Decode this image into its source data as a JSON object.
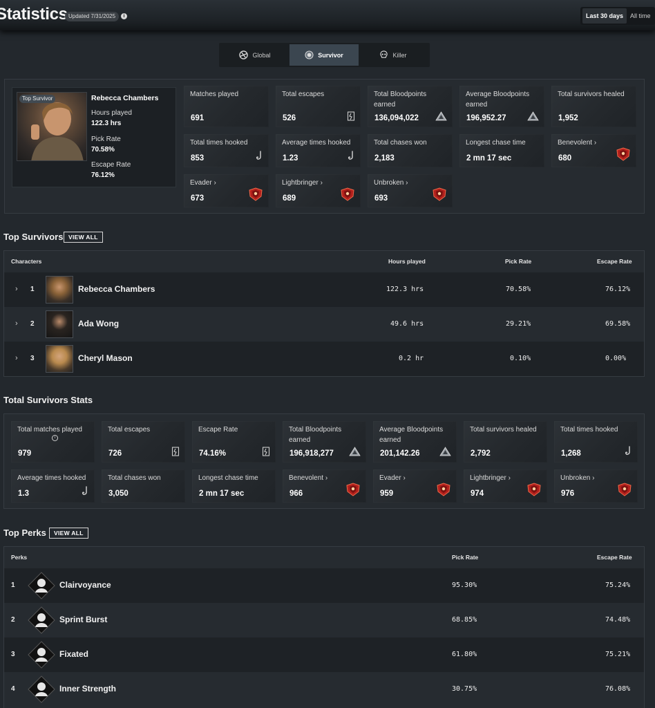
{
  "header": {
    "title": "Statistics",
    "updated": "Updated 7/31/2025",
    "info_icon": "info-icon",
    "range": {
      "active": "Last 30 days",
      "other": "All time"
    }
  },
  "tabs": [
    {
      "label": "Global",
      "icon": "global-icon"
    },
    {
      "label": "Survivor",
      "icon": "survivor-icon",
      "active": true
    },
    {
      "label": "Killer",
      "icon": "killer-icon"
    }
  ],
  "top_survivor": {
    "badge": "Top Survivor",
    "name": "Rebecca Chambers",
    "hours_label": "Hours played",
    "hours_value": "122.3 hrs",
    "pick_label": "Pick Rate",
    "pick_value": "70.58%",
    "escape_label": "Escape Rate",
    "escape_value": "76.12%"
  },
  "survivor_cards": [
    {
      "label": "Matches played",
      "value": "691",
      "icon": ""
    },
    {
      "label": "Total escapes",
      "value": "526",
      "icon": "exit-door-icon"
    },
    {
      "label": "Total Bloodpoints earned",
      "value": "136,094,022",
      "icon": "bloodpoints-icon"
    },
    {
      "label": "Average Bloodpoints earned",
      "value": "196,952.27",
      "icon": "bloodpoints-icon"
    },
    {
      "label": "Total survivors healed",
      "value": "1,952",
      "icon": ""
    },
    {
      "label": "Total times hooked",
      "value": "853",
      "icon": "hook-icon"
    },
    {
      "label": "Average times hooked",
      "value": "1.23",
      "icon": "hook-icon"
    },
    {
      "label": "Total chases won",
      "value": "2,183",
      "icon": ""
    },
    {
      "label": "Longest chase time",
      "value": "2 mn 17 sec",
      "icon": ""
    },
    {
      "label": "Benevolent ›",
      "value": "680",
      "icon": "emblem-icon"
    },
    {
      "label": "Evader ›",
      "value": "673",
      "icon": "emblem-icon"
    },
    {
      "label": "Lightbringer ›",
      "value": "689",
      "icon": "emblem-icon"
    },
    {
      "label": "Unbroken ›",
      "value": "693",
      "icon": "emblem-icon"
    }
  ],
  "top_survivors": {
    "title": "Top Survivors",
    "view_all": "VIEW ALL",
    "headers": {
      "characters": "Characters",
      "hours": "Hours played",
      "pick": "Pick Rate",
      "escape": "Escape Rate"
    },
    "rows": [
      {
        "rank": "1",
        "name": "Rebecca Chambers",
        "hours": "122.3 hrs",
        "pick": "70.58%",
        "escape": "76.12%"
      },
      {
        "rank": "2",
        "name": "Ada Wong",
        "hours": "49.6 hrs",
        "pick": "29.21%",
        "escape": "69.58%"
      },
      {
        "rank": "3",
        "name": "Cheryl Mason",
        "hours": "0.2 hr",
        "pick": "0.10%",
        "escape": "0.00%"
      }
    ]
  },
  "total_stats": {
    "title": "Total Survivors Stats",
    "cards": [
      {
        "label": "Total matches played",
        "value": "979",
        "icon": "",
        "info": true
      },
      {
        "label": "Total escapes",
        "value": "726",
        "icon": "exit-door-icon"
      },
      {
        "label": "Escape Rate",
        "value": "74.16%",
        "icon": "exit-door-icon"
      },
      {
        "label": "Total Bloodpoints earned",
        "value": "196,918,277",
        "icon": "bloodpoints-icon"
      },
      {
        "label": "Average Bloodpoints earned",
        "value": "201,142.26",
        "icon": "bloodpoints-icon"
      },
      {
        "label": "Total survivors healed",
        "value": "2,792",
        "icon": ""
      },
      {
        "label": "Total times hooked",
        "value": "1,268",
        "icon": "hook-icon"
      },
      {
        "label": "Average times hooked",
        "value": "1.3",
        "icon": "hook-icon"
      },
      {
        "label": "Total chases won",
        "value": "3,050",
        "icon": ""
      },
      {
        "label": "Longest chase time",
        "value": "2 mn 17 sec",
        "icon": ""
      },
      {
        "label": "Benevolent ›",
        "value": "966",
        "icon": "emblem-icon"
      },
      {
        "label": "Evader ›",
        "value": "959",
        "icon": "emblem-icon"
      },
      {
        "label": "Lightbringer ›",
        "value": "974",
        "icon": "emblem-icon"
      },
      {
        "label": "Unbroken ›",
        "value": "976",
        "icon": "emblem-icon"
      }
    ]
  },
  "top_perks": {
    "title": "Top Perks",
    "view_all": "VIEW ALL",
    "headers": {
      "perks": "Perks",
      "pick": "Pick Rate",
      "escape": "Escape Rate"
    },
    "rows": [
      {
        "rank": "1",
        "name": "Clairvoyance",
        "pick": "95.30%",
        "escape": "75.24%"
      },
      {
        "rank": "2",
        "name": "Sprint Burst",
        "pick": "68.85%",
        "escape": "74.48%"
      },
      {
        "rank": "3",
        "name": "Fixated",
        "pick": "61.80%",
        "escape": "75.21%"
      },
      {
        "rank": "4",
        "name": "Inner Strength",
        "pick": "30.75%",
        "escape": "76.08%"
      }
    ]
  }
}
